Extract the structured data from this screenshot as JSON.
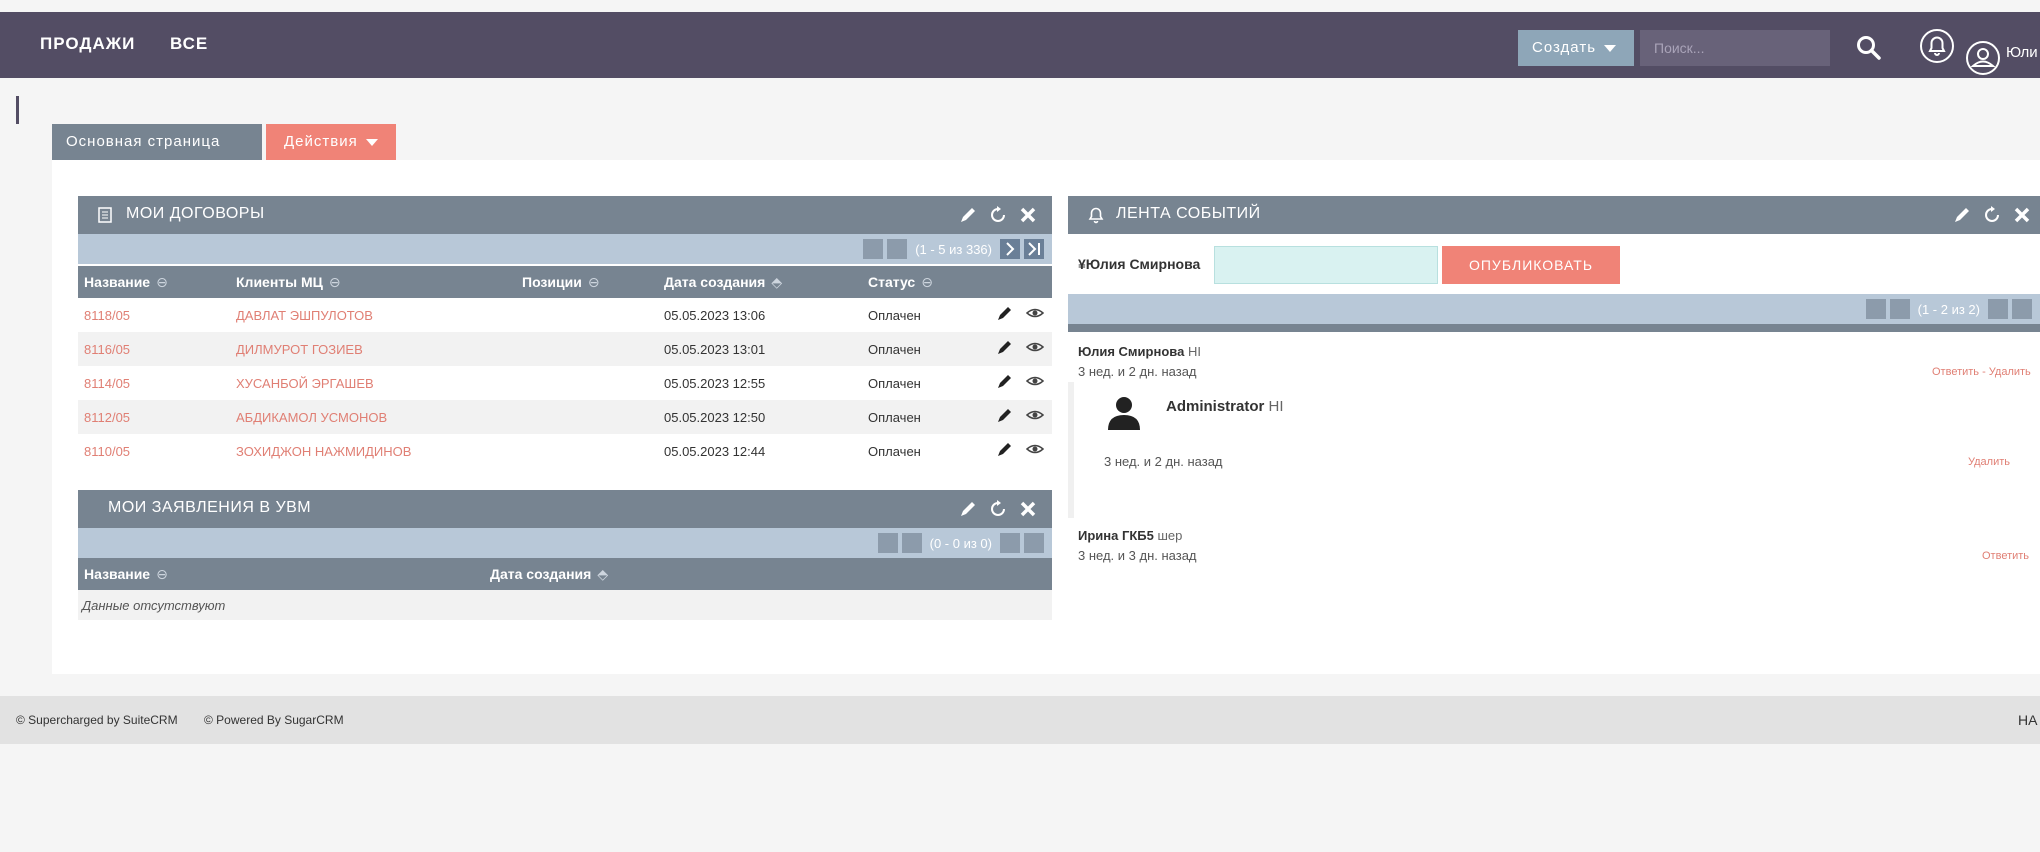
{
  "nav": {
    "items": [
      "ПРОДАЖИ",
      "ВСЕ"
    ],
    "create_label": "Создать",
    "search_placeholder": "Поиск...",
    "user_name": "Юли"
  },
  "tabs": {
    "main": "Основная страница",
    "actions": "Действия"
  },
  "contracts": {
    "title": "МОИ ДОГОВОРЫ",
    "pager": "(1 - 5 из 336)",
    "columns": [
      "Название",
      "Клиенты МЦ",
      "Позиции",
      "Дата создания",
      "Статус"
    ],
    "rows": [
      {
        "name": "8118/05",
        "client": "ДАВЛАТ ЭШПУЛОТОВ",
        "date": "05.05.2023 13:06",
        "status": "Оплачен"
      },
      {
        "name": "8116/05",
        "client": "ДИЛМУРОТ ГОЗИЕВ",
        "date": "05.05.2023 13:01",
        "status": "Оплачен"
      },
      {
        "name": "8114/05",
        "client": "ХУСАНБОЙ ЭРГАШЕВ",
        "date": "05.05.2023 12:55",
        "status": "Оплачен"
      },
      {
        "name": "8112/05",
        "client": "АБДИКАМОЛ УСМОНОВ",
        "date": "05.05.2023 12:50",
        "status": "Оплачен"
      },
      {
        "name": "8110/05",
        "client": "ЗОХИДЖОН НАЖМИДИНОВ",
        "date": "05.05.2023 12:44",
        "status": "Оплачен"
      }
    ]
  },
  "applications": {
    "title": "МОИ ЗАЯВЛЕНИЯ В УВМ",
    "pager": "(0 - 0 из 0)",
    "columns": [
      "Название",
      "Дата создания"
    ],
    "empty_text": "Данные отсутствуют"
  },
  "feed": {
    "title": "ЛЕНТА СОБЫТИЙ",
    "user": "Юлия Смирнова",
    "publish_label": "ОПУБЛИКОВАТЬ",
    "pager": "(1 - 2 из 2)",
    "posts": [
      {
        "author": "Юлия Смирнова",
        "text": "HI",
        "time": "3 нед. и 2 дн. назад",
        "links": "Ответить - Удалить"
      },
      {
        "author": "Ирина ГКБ5",
        "text": "шер",
        "time": "3 нед. и 3 дн. назад",
        "links": "Ответить"
      }
    ],
    "reply": {
      "author": "Administrator",
      "text": "HI",
      "time": "3 нед. и 2 дн. назад",
      "link": "Удалить"
    }
  },
  "footer": {
    "supercharged": "© Supercharged by SuiteCRM",
    "powered": "© Powered By SugarCRM",
    "right": "НА"
  },
  "colors": {
    "nav": "#534d64",
    "header": "#778491",
    "accent": "#f08377",
    "link": "#e07f74"
  }
}
